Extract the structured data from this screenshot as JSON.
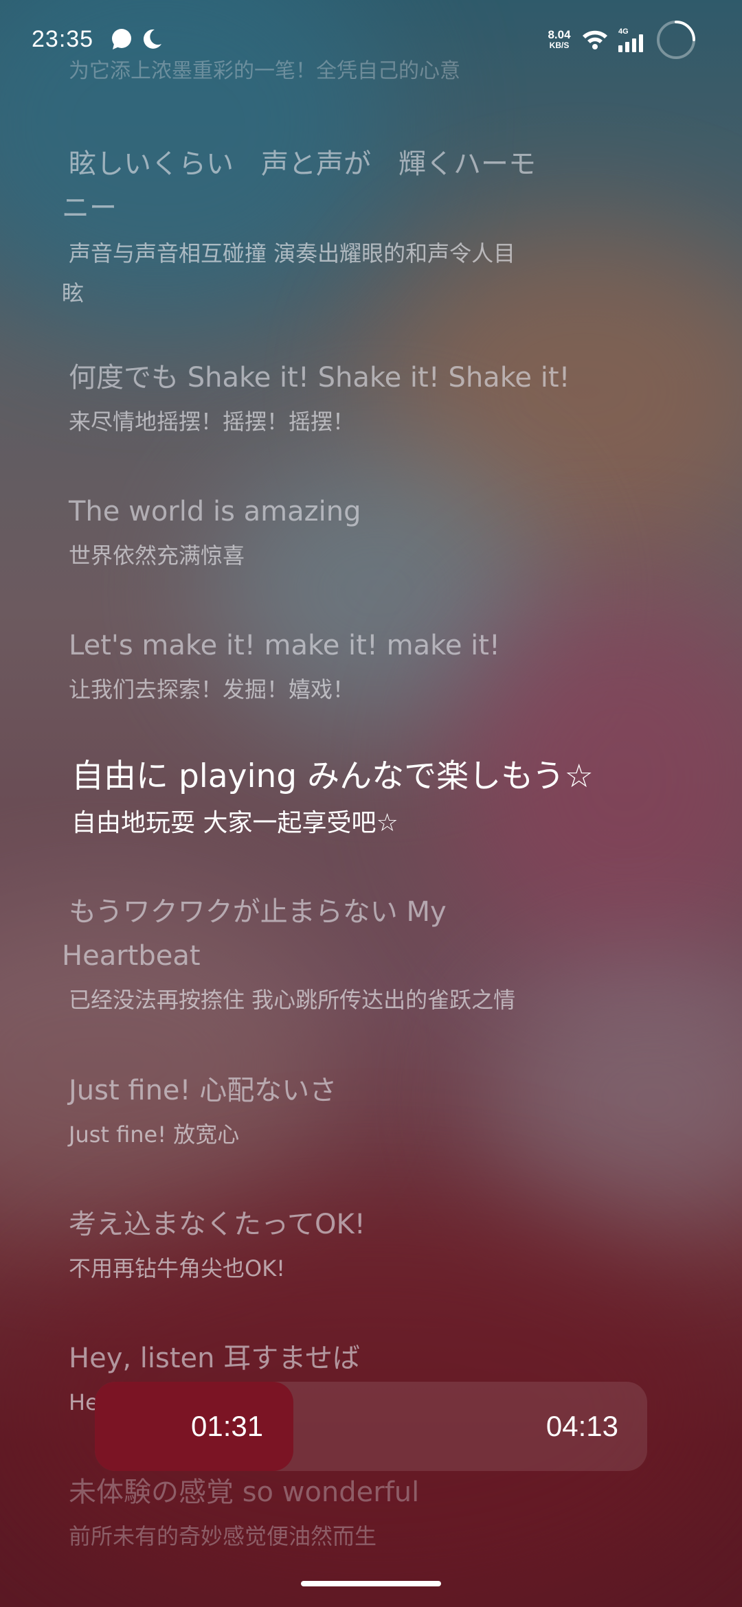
{
  "status_bar": {
    "time": "23:35",
    "net_speed_value": "8.04",
    "net_speed_unit": "KB/S",
    "signal_label": "4G",
    "icons": [
      "chat-bubble-icon",
      "moon-icon",
      "wifi-icon",
      "cell-signal-icon",
      "loading-ring-icon"
    ]
  },
  "lyrics": [
    {
      "orig": "",
      "trans": "为它添上浓墨重彩的一笔！全凭自己的心意",
      "state": "faded"
    },
    {
      "orig": "眩しいくらい　声と声が　輝くハーモ",
      "orig_cont": "ニー",
      "trans": "声音与声音相互碰撞 演奏出耀眼的和声令人目",
      "trans_cont": "眩",
      "state": "normal"
    },
    {
      "orig": "何度でも Shake it! Shake it! Shake it!",
      "trans": "来尽情地摇摆！摇摆！摇摆！",
      "state": "normal"
    },
    {
      "orig": "The world is amazing",
      "trans": "世界依然充满惊喜",
      "state": "normal"
    },
    {
      "orig": "Let's make it! make it! make it!",
      "trans": "让我们去探索！发掘！嬉戏！",
      "state": "normal"
    },
    {
      "orig": "自由に playing みんなで楽しもう☆",
      "trans": "自由地玩耍 大家一起享受吧☆",
      "state": "active"
    },
    {
      "orig": "もうワクワクが止まらない My",
      "orig_cont": "Heartbeat",
      "trans": "已经没法再按捺住 我心跳所传达出的雀跃之情",
      "state": "normal"
    },
    {
      "orig": "Just fine! 心配ないさ",
      "trans": "Just fine! 放宽心",
      "state": "normal"
    },
    {
      "orig": "考え込まなくたってOK!",
      "trans": "不用再钻牛角尖也OK!",
      "state": "normal"
    },
    {
      "orig": "Hey, listen 耳すませば",
      "trans": "Hey, listen 侧耳倾听",
      "state": "normal"
    },
    {
      "orig": "未体験の感覚 so wonderful",
      "trans": "前所未有的奇妙感觉便油然而生",
      "state": "faded"
    }
  ],
  "player": {
    "current_time": "01:31",
    "total_time": "04:13",
    "progress_fraction": 0.36,
    "accent_color": "#7b1424"
  }
}
